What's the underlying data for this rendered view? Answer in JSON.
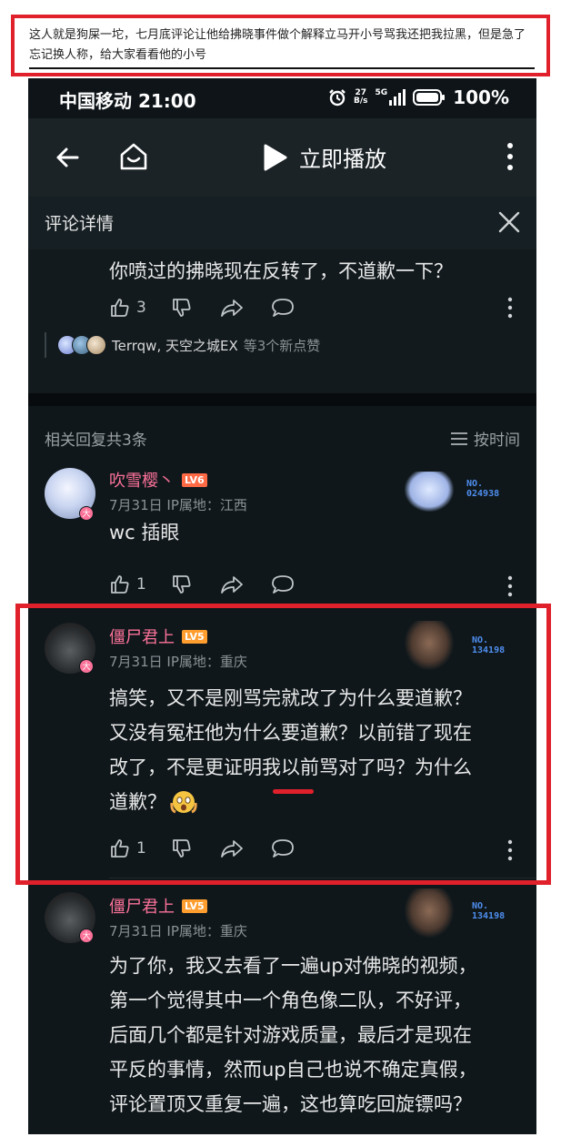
{
  "annotation": {
    "caption": "这人就是狗屎一坨，七月底评论让他给拂晓事件做个解释立马开小号骂我还把我拉黑，但是急了忘记换人称，给大家看看他的小号"
  },
  "status_bar": {
    "carrier_time": "中国移动 21:00",
    "net_speed_value": "27",
    "net_speed_unit": "B/s",
    "network": "5G",
    "battery": "100%"
  },
  "nav": {
    "play_label": "立即播放"
  },
  "detail": {
    "title": "评论详情"
  },
  "original_comment": {
    "text": "你喷过的拂晓现在反转了，不道歉一下？",
    "likes": "3",
    "likers_names": "Terrqw, 天空之城EX",
    "likers_extra": "等3个新点赞"
  },
  "replies_header": {
    "count_label": "相关回复共3条",
    "sort_label": "按时间"
  },
  "replies": [
    {
      "username": "吹雪樱丶",
      "level": "LV6",
      "level_color": "#ff6a45",
      "meta": "7月31日  IP属地：江西",
      "text": "wc 插眼",
      "likes": "1",
      "fan_no_label": "NO.",
      "fan_no": "024938"
    },
    {
      "username": "僵尸君上",
      "level": "LV5",
      "level_color": "#ff9d2f",
      "meta": "7月31日  IP属地：重庆",
      "text_lines": [
        "搞笑，又不是刚骂完就改了为什么要道歉？",
        "又没有冤枉他为什么要道歉？以前错了现在",
        "改了，不是更证明我以前骂对了吗？为什么",
        "道歉？"
      ],
      "likes": "1",
      "fan_no_label": "NO.",
      "fan_no": "134198"
    },
    {
      "username": "僵尸君上",
      "level": "LV5",
      "level_color": "#ff9d2f",
      "meta": "7月31日  IP属地：重庆",
      "text_lines": [
        "为了你，我又去看了一遍up对佛晓的视频，",
        "第一个觉得其中一个角色像二队，不好评，",
        "后面几个都是针对游戏质量，最后才是现在",
        "平反的事情，然而up自己也说不确定真假，",
        "评论置顶又重复一遍，这也算吃回旋镖吗？"
      ],
      "fan_no_label": "NO.",
      "fan_no": "134198"
    }
  ],
  "avatar_badge": "大",
  "colors": {
    "accent_pink": "#fb7299",
    "highlight_red": "#e0202a",
    "background": "#0f171b"
  }
}
